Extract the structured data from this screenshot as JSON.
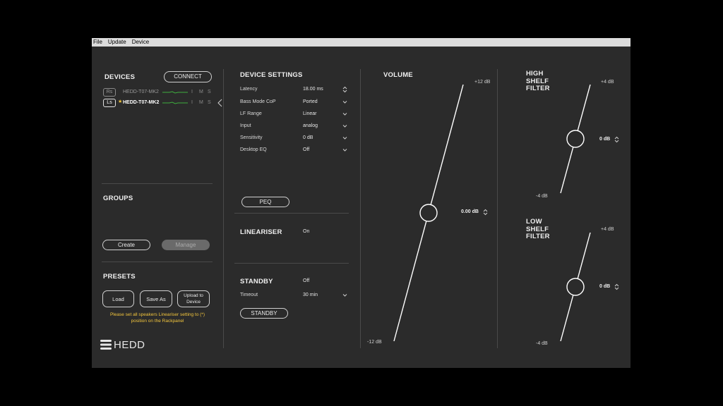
{
  "menu": [
    "File",
    "Update",
    "Device"
  ],
  "devices": {
    "title": "DEVICES",
    "connect_label": "CONNECT",
    "rows": [
      {
        "tag": "Rs",
        "name": "HEDD-T07-MK2",
        "star": "",
        "i": "I",
        "m": "M",
        "s": "S"
      },
      {
        "tag": "Ls",
        "name": "HEDD-T07-MK2",
        "star": "★",
        "i": "I",
        "m": "M",
        "s": "S"
      }
    ]
  },
  "groups": {
    "title": "GROUPS",
    "create_label": "Create",
    "manage_label": "Manage"
  },
  "presets": {
    "title": "PRESETS",
    "load_label": "Load",
    "save_as_label": "Save As",
    "upload_label": "Upload to Device",
    "warning": "Please set all speakers Lineariser setting to (*) position on the Rackpanel"
  },
  "logo_text": "HEDD",
  "device_settings": {
    "title": "DEVICE SETTINGS",
    "rows": [
      {
        "label": "Latency",
        "value": "18.00 ms"
      },
      {
        "label": "Bass Mode CoP",
        "value": "Ported"
      },
      {
        "label": "LF Range",
        "value": "Linear"
      },
      {
        "label": "Input",
        "value": "analog"
      },
      {
        "label": "Sensitivity",
        "value": "0 dB"
      },
      {
        "label": "Desktop EQ",
        "value": "Off"
      }
    ],
    "peq_label": "PEQ"
  },
  "lineariser": {
    "title": "LINEARISER",
    "value": "On"
  },
  "standby": {
    "title": "STANDBY",
    "value": "Off",
    "timeout_label": "Timeout",
    "timeout_value": "30 min",
    "button_label": "STANDBY"
  },
  "volume": {
    "title": "VOLUME",
    "max_label": "+12 dB",
    "min_label": "-12 dB",
    "value_label": "0.00 dB",
    "level": 0.5
  },
  "high_shelf": {
    "title": "HIGH SHELF FILTER",
    "max_label": "+4 dB",
    "min_label": "-4 dB",
    "value_label": "0 dB",
    "level": 0.5
  },
  "low_shelf": {
    "title": "LOW SHELF FILTER",
    "max_label": "+4 dB",
    "min_label": "-4 dB",
    "value_label": "0 dB",
    "level": 0.5
  }
}
